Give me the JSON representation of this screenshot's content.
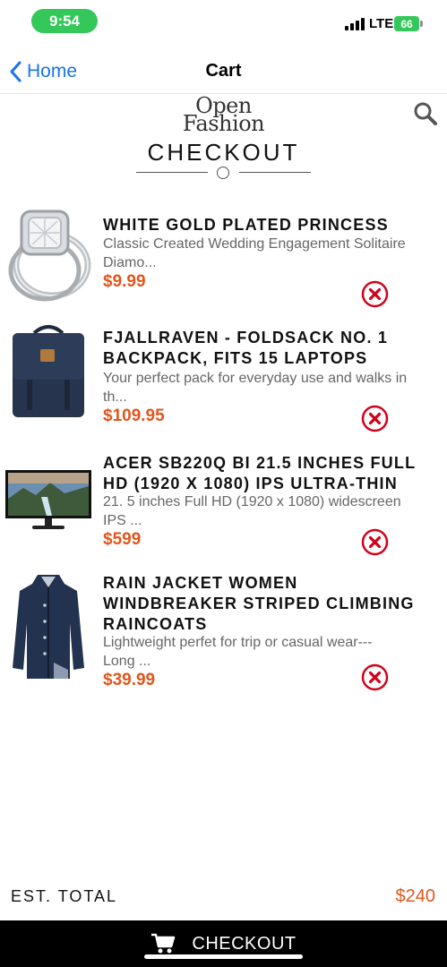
{
  "status_bar": {
    "time": "9:54",
    "network": "LTE",
    "battery": "66"
  },
  "nav": {
    "back_label": "Home",
    "title": "Cart"
  },
  "brand": {
    "logo_line1": "Open",
    "logo_line2": "Fashion"
  },
  "heading": "CHECKOUT",
  "items": [
    {
      "title_line1": "WHITE GOLD PLATED PRINCESS",
      "title_line2": "",
      "title_line3": "",
      "desc_line1": "Classic Created Wedding Engagement Solitaire",
      "desc_line2": "Diamo...",
      "price": "$9.99",
      "image": "ring-image"
    },
    {
      "title_line1": "FJALLRAVEN - FOLDSACK NO. 1",
      "title_line2": "BACKPACK, FITS 15 LAPTOPS",
      "title_line3": "",
      "desc_line1": "Your perfect pack for everyday use and walks in",
      "desc_line2": "th...",
      "price": "$109.95",
      "image": "backpack-image"
    },
    {
      "title_line1": "ACER SB220Q BI 21.5 INCHES FULL",
      "title_line2": "HD (1920 X 1080) IPS ULTRA-THIN",
      "title_line3": "",
      "desc_line1": "21. 5 inches Full HD (1920 x 1080) widescreen",
      "desc_line2": "IPS ...",
      "price": "$599",
      "image": "monitor-image"
    },
    {
      "title_line1": "RAIN JACKET WOMEN",
      "title_line2": "WINDBREAKER STRIPED CLIMBING",
      "title_line3": "RAINCOATS",
      "desc_line1": "Lightweight perfet for trip or casual wear---",
      "desc_line2": "Long ...",
      "price": "$39.99",
      "image": "jacket-image"
    }
  ],
  "footer": {
    "total_label": "EST. TOTAL",
    "total_value": "$240",
    "checkout_label": "CHECKOUT"
  },
  "colors": {
    "accent": "#e0561c",
    "link": "#1a73e8",
    "remove": "#d0021b",
    "status_green": "#34c759"
  },
  "icons": {
    "back": "chevron-left-icon",
    "search": "search-icon",
    "remove": "remove-circle-icon",
    "cart": "cart-icon"
  }
}
